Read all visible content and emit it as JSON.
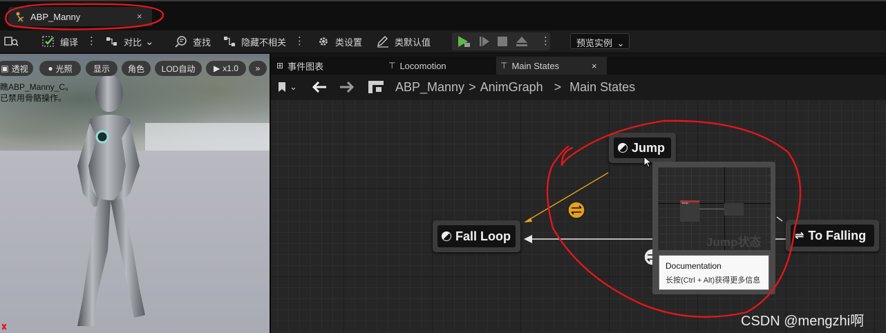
{
  "document_tab": {
    "title": "ABP_Manny",
    "close": "×"
  },
  "toolbar": {
    "compile": "编译",
    "diff": "对比",
    "find": "查找",
    "hide_unrelated": "隐藏不相关",
    "class_settings": "类设置",
    "class_defaults": "类默认值",
    "preview_instance": "预览实例"
  },
  "viewport": {
    "buttons": {
      "perspective": "透视",
      "lit": "光照",
      "show": "显示",
      "character": "角色",
      "lod": "LOD自动",
      "speed": "x1.0",
      "more": "»"
    },
    "info_line1": "瞧ABP_Manny_C。",
    "info_line2": "已禁用骨骼操作。"
  },
  "graph_tabs": [
    {
      "label": "事件图表"
    },
    {
      "label": "Locomotion"
    },
    {
      "label": "Main States",
      "close": "×"
    }
  ],
  "breadcrumb": {
    "root": "ABP_Manny",
    "sep1": ">",
    "mid": "AnimGraph",
    "sep2": ">",
    "leaf": "Main States"
  },
  "nodes": {
    "jump": "Jump",
    "fall_loop": "Fall Loop",
    "to_falling": "To Falling"
  },
  "tooltip": {
    "thumb_node_a": "Jump",
    "thumb_watermark": "Jump状态",
    "title": "Documentation",
    "hint": "长按(Ctrl + Alt)获得更多信息"
  },
  "watermark": "CSDN @mengzhi啊",
  "colors": {
    "transition_orange": "#e6a01c",
    "annotation_red": "#e4161c",
    "play_green": "#5fb84a"
  }
}
